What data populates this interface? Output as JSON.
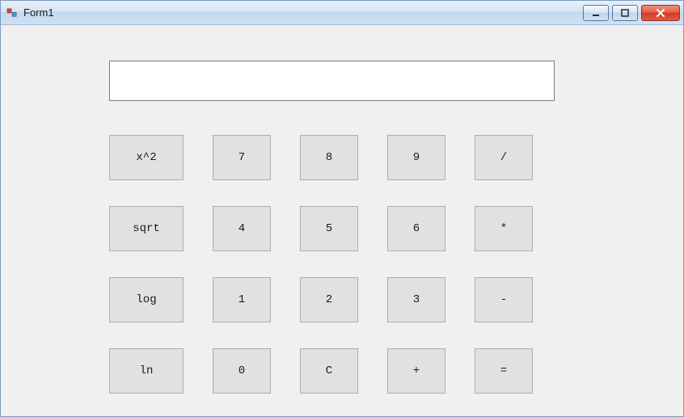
{
  "window": {
    "title": "Form1"
  },
  "display": {
    "value": "",
    "placeholder": ""
  },
  "buttons": {
    "r0c0": "x^2",
    "r0c1": "7",
    "r0c2": "8",
    "r0c3": "9",
    "r0c4": "/",
    "r1c0": "sqrt",
    "r1c1": "4",
    "r1c2": "5",
    "r1c3": "6",
    "r1c4": "*",
    "r2c0": "log",
    "r2c1": "1",
    "r2c2": "2",
    "r2c3": "3",
    "r2c4": "-",
    "r3c0": "ln",
    "r3c1": "0",
    "r3c2": "C",
    "r3c3": "+",
    "r3c4": "="
  }
}
